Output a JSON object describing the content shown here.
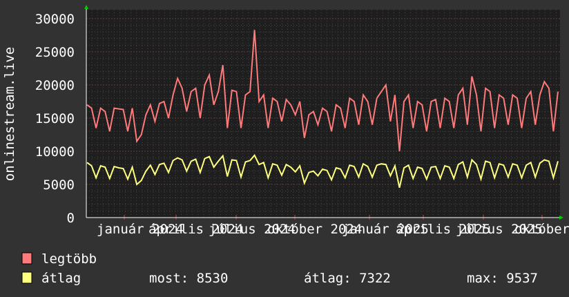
{
  "chart_data": {
    "type": "line",
    "ylabel": "onlinestream.live",
    "ylim": [
      0,
      30000
    ],
    "yticks": [
      0,
      5000,
      10000,
      15000,
      20000,
      25000,
      30000
    ],
    "xtick_labels": [
      "január 2024",
      "április 2024",
      "július 2024",
      "október 2024",
      "január 2025",
      "április 2025",
      "július 2025",
      "október 2025"
    ],
    "grid": true,
    "legend_placement": "bottom-left",
    "series": [
      {
        "name": "legtöbb",
        "color": "#ff7a7a",
        "values": [
          17000,
          16500,
          13500,
          16500,
          16000,
          13000,
          16500,
          16400,
          16300,
          13000,
          16500,
          11500,
          12500,
          15500,
          17000,
          14500,
          17200,
          17500,
          15000,
          18500,
          21000,
          19500,
          16000,
          19000,
          19500,
          15000,
          20000,
          21500,
          17000,
          19000,
          23000,
          13500,
          19200,
          19000,
          13500,
          18500,
          19000,
          28300,
          17500,
          18500,
          13500,
          18000,
          17500,
          14500,
          17800,
          17000,
          15500,
          17500,
          12000,
          15500,
          16000,
          14000,
          16500,
          16000,
          13000,
          17000,
          16500,
          13500,
          18000,
          17500,
          14000,
          18500,
          17500,
          14000,
          18000,
          19000,
          20000,
          14500,
          18500,
          10000,
          17500,
          18500,
          13500,
          17500,
          17000,
          13000,
          17500,
          17800,
          13500,
          18000,
          17500,
          13500,
          18500,
          19500,
          14000,
          21300,
          18500,
          13000,
          19500,
          19000,
          13500,
          18500,
          18000,
          14000,
          18500,
          18000,
          13500,
          18000,
          19000,
          14000,
          18500,
          20500,
          19500,
          13000,
          19000
        ]
      },
      {
        "name": "átlag",
        "color": "#ffff80",
        "values": [
          8300,
          7800,
          6000,
          7800,
          7600,
          5900,
          7700,
          7500,
          7400,
          5800,
          7600,
          5000,
          5600,
          7000,
          7900,
          6500,
          8000,
          8200,
          6800,
          8600,
          9000,
          8700,
          7000,
          8500,
          8800,
          6800,
          8900,
          9200,
          7600,
          8500,
          9300,
          6200,
          8700,
          8600,
          6100,
          8400,
          8600,
          9400,
          8000,
          8300,
          6000,
          8100,
          7900,
          6400,
          8000,
          7600,
          6900,
          7800,
          5200,
          6800,
          7000,
          6300,
          7300,
          7100,
          5700,
          7500,
          7300,
          6000,
          7900,
          7700,
          6100,
          8100,
          7700,
          6100,
          7900,
          8100,
          8000,
          6300,
          7800,
          4500,
          7500,
          7900,
          5900,
          7600,
          7400,
          5800,
          7600,
          7700,
          5900,
          7800,
          7600,
          5900,
          8000,
          8400,
          6100,
          8700,
          8000,
          5800,
          8500,
          8300,
          6000,
          8100,
          7900,
          6100,
          8100,
          7900,
          6000,
          7900,
          8300,
          6100,
          8200,
          8700,
          8500,
          6000,
          8500
        ]
      }
    ]
  },
  "legend": {
    "max_label": "legtöbb",
    "avg_label": "átlag",
    "stats": {
      "now": "most: 8530",
      "avg": "átlag: 7322",
      "max": "max: 9537"
    }
  }
}
